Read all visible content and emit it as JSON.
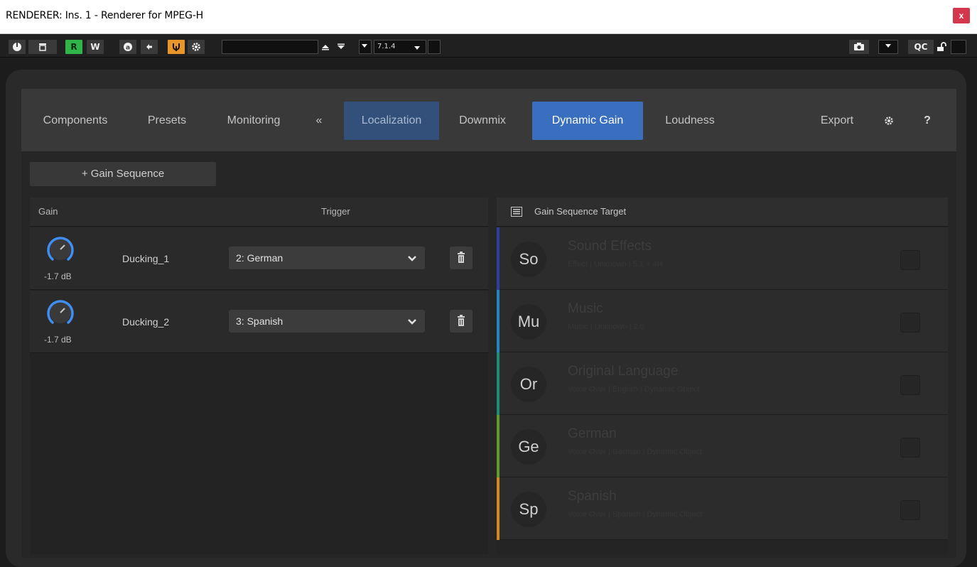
{
  "window": {
    "title": "RENDERER: Ins. 1 - Renderer for MPEG-H",
    "close_label": "x"
  },
  "host_toolbar": {
    "r_label": "R",
    "w_label": "W",
    "format_value": "7.1.4",
    "qc_label": "QC"
  },
  "tabs": [
    {
      "label": "Components",
      "state": "normal"
    },
    {
      "label": "Presets",
      "state": "normal"
    },
    {
      "label": "Monitoring",
      "state": "normal"
    },
    {
      "label": "«",
      "state": "normal"
    },
    {
      "label": "Localization",
      "state": "muted"
    },
    {
      "label": "Downmix",
      "state": "normal"
    },
    {
      "label": "Dynamic Gain",
      "state": "active"
    },
    {
      "label": "Loudness",
      "state": "normal"
    },
    {
      "label": "Export",
      "state": "normal"
    },
    {
      "label": "?",
      "state": "normal"
    }
  ],
  "add_gain_sequence_label": "+ Gain Sequence",
  "gain_table": {
    "headers": {
      "gain": "Gain",
      "trigger": "Trigger"
    },
    "rows": [
      {
        "gain": "-1.7 dB",
        "name": "Ducking_1",
        "trigger": "2: German"
      },
      {
        "gain": "-1.7 dB",
        "name": "Ducking_2",
        "trigger": "3: Spanish"
      }
    ]
  },
  "target_panel": {
    "title": "Gain Sequence Target",
    "items": [
      {
        "abbr": "So",
        "name": "Sound Effects",
        "sub": "Effect | Unknown | 5.1 + 4H",
        "color": "#2c3e9e",
        "checked": false
      },
      {
        "abbr": "Mu",
        "name": "Music",
        "sub": "Music | Unknown | 2.0",
        "color": "#1f86c8",
        "checked": false
      },
      {
        "abbr": "Or",
        "name": "Original Language",
        "sub": "Voice Over | English | Dynamic Object",
        "color": "#1a8c7e",
        "checked": false
      },
      {
        "abbr": "Ge",
        "name": "German",
        "sub": "Voice Over | German | Dynamic Object",
        "color": "#5e9a2c",
        "checked": false
      },
      {
        "abbr": "Sp",
        "name": "Spanish",
        "sub": "Voice Over | Spanish | Dynamic Object",
        "color": "#d4871a",
        "checked": false
      }
    ]
  },
  "colors": {
    "accent": "#3a6fc0",
    "knob_arc": "#3f8ef0",
    "toolbar_green": "#2fb54a",
    "toolbar_orange": "#e8962a"
  },
  "icons": [
    "power-icon",
    "compare-icon",
    "automation-icon",
    "arrow-left-icon",
    "link-icon",
    "gear-icon",
    "up-arrow-icon",
    "down-arrow-icon",
    "dropdown-arrow-icon",
    "camera-icon",
    "lock-open-icon",
    "trash-icon",
    "list-icon",
    "chevron-down-icon"
  ]
}
